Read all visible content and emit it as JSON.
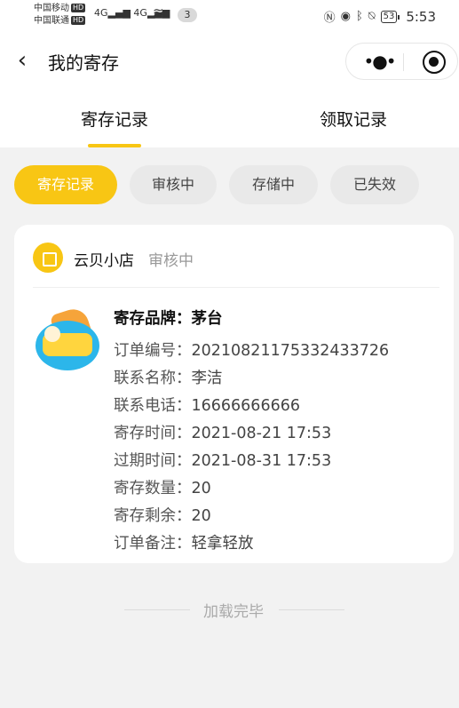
{
  "status_bar": {
    "carrier1": "中国移动",
    "carrier2": "中国联通",
    "hd": "HD",
    "signal1": "4G",
    "signal2": "4G",
    "notification_count": "3",
    "battery": "53",
    "time": "5:53"
  },
  "nav": {
    "title": "我的寄存",
    "more_glyph": "•●•"
  },
  "top_tabs": [
    {
      "label": "寄存记录",
      "active": true
    },
    {
      "label": "领取记录",
      "active": false
    }
  ],
  "filter_chips": [
    {
      "label": "寄存记录",
      "active": true
    },
    {
      "label": "审核中",
      "active": false
    },
    {
      "label": "存储中",
      "active": false
    },
    {
      "label": "已失效",
      "active": false
    }
  ],
  "record": {
    "shop_name": "云贝小店",
    "status": "审核中",
    "fields": [
      {
        "label": "寄存品牌：",
        "value": "茅台"
      },
      {
        "label": "订单编号：",
        "value": "20210821175332433726"
      },
      {
        "label": "联系名称：",
        "value": "李洁"
      },
      {
        "label": "联系电话：",
        "value": "16666666666"
      },
      {
        "label": "寄存时间：",
        "value": "2021-08-21 17:53"
      },
      {
        "label": "过期时间：",
        "value": "2021-08-31 17:53"
      },
      {
        "label": "寄存数量：",
        "value": "20"
      },
      {
        "label": "寄存剩余：",
        "value": "20"
      },
      {
        "label": "订单备注：",
        "value": "轻拿轻放"
      }
    ]
  },
  "footer": {
    "load_text": "加载完毕"
  },
  "colors": {
    "accent": "#f8c614",
    "background": "#f2f2f2",
    "muted": "#999999"
  }
}
